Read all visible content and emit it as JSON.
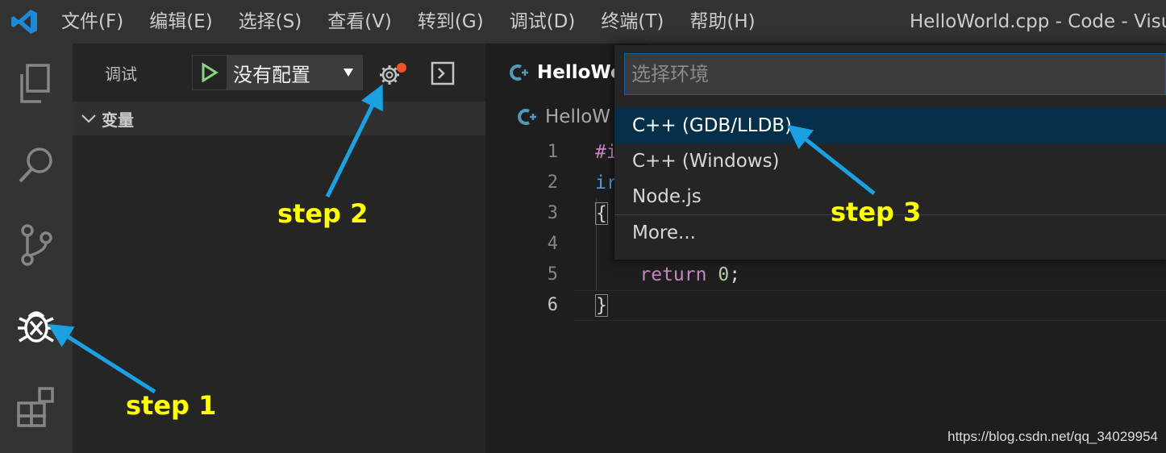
{
  "titlebar": {
    "menu": [
      "文件(F)",
      "编辑(E)",
      "选择(S)",
      "查看(V)",
      "转到(G)",
      "调试(D)",
      "终端(T)",
      "帮助(H)"
    ],
    "window_title": "HelloWorld.cpp - Code - Visua"
  },
  "activitybar": {
    "items": [
      "files-icon",
      "search-icon",
      "source-control-icon",
      "debug-icon",
      "extensions-icon"
    ]
  },
  "sidebar": {
    "title": "调试",
    "config_selected": "没有配置",
    "section_title": "变量"
  },
  "editor": {
    "tab_label": "HelloWo",
    "breadcrumb": "HelloW",
    "line_numbers": [
      "1",
      "2",
      "3",
      "4",
      "5",
      "6"
    ],
    "code": {
      "l1": "#i",
      "l2": "ir",
      "l3": "{",
      "l5_kw": "return",
      "l5_num": "0",
      "l5_semi": ";",
      "l6": "}"
    }
  },
  "quickpick": {
    "placeholder": "选择环境",
    "items": [
      "C++ (GDB/LLDB)",
      "C++ (Windows)",
      "Node.js",
      "More..."
    ]
  },
  "annotations": {
    "step1": "step 1",
    "step2": "step 2",
    "step3": "step 3"
  },
  "watermark": "https://blog.csdn.net/qq_34029954",
  "colors": {
    "accent": "#0e639c",
    "arrow": "#1ba1e2",
    "annotation_text": "#ffff00",
    "play": "#89d185",
    "badge": "#f0542c"
  }
}
